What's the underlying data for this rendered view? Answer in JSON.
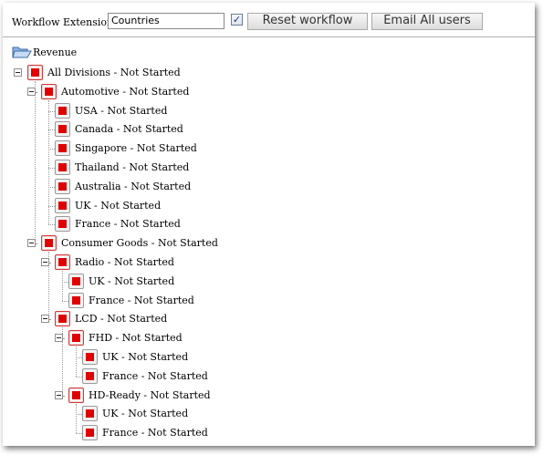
{
  "toolbar": {
    "label": "Workflow Extension",
    "input_value": "Countries",
    "checkbox_checked": true,
    "reset_label": "Reset workflow",
    "email_label": "Email All users"
  },
  "tree": {
    "root": {
      "label": "Revenue",
      "icon": "folder-open-icon"
    },
    "nodes": [
      {
        "label": "All Divisions - Not Started",
        "level": 0,
        "parent": true
      },
      {
        "label": "Automotive - Not Started",
        "level": 1,
        "parent": true
      },
      {
        "label": "USA - Not Started",
        "level": 2,
        "parent": false
      },
      {
        "label": "Canada - Not Started",
        "level": 2,
        "parent": false
      },
      {
        "label": "Singapore - Not Started",
        "level": 2,
        "parent": false
      },
      {
        "label": "Thailand - Not Started",
        "level": 2,
        "parent": false
      },
      {
        "label": "Australia - Not Started",
        "level": 2,
        "parent": false
      },
      {
        "label": "UK - Not Started",
        "level": 2,
        "parent": false
      },
      {
        "label": "France - Not Started",
        "level": 2,
        "parent": false
      },
      {
        "label": "Consumer Goods - Not Started",
        "level": 1,
        "parent": true
      },
      {
        "label": "Radio - Not Started",
        "level": 2,
        "parent": true
      },
      {
        "label": "UK - Not Started",
        "level": 3,
        "parent": false
      },
      {
        "label": "France - Not Started",
        "level": 3,
        "parent": false
      },
      {
        "label": "LCD - Not Started",
        "level": 2,
        "parent": true
      },
      {
        "label": "FHD - Not Started",
        "level": 3,
        "parent": true
      },
      {
        "label": "UK - Not Started",
        "level": 4,
        "parent": false
      },
      {
        "label": "France - Not Started",
        "level": 4,
        "parent": false
      },
      {
        "label": "HD-Ready - Not Started",
        "level": 3,
        "parent": true
      },
      {
        "label": "UK - Not Started",
        "level": 4,
        "parent": false
      },
      {
        "label": "France - Not Started",
        "level": 4,
        "parent": false
      }
    ],
    "status_color": "#e00000"
  }
}
